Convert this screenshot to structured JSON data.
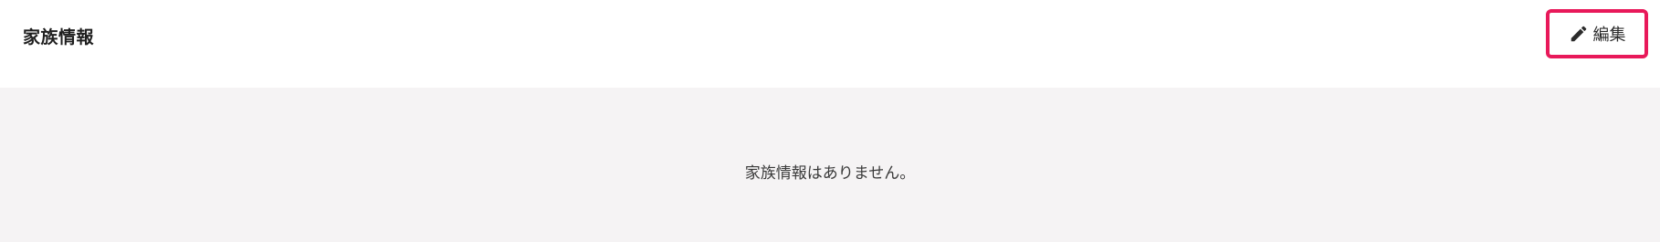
{
  "section": {
    "title": "家族情報",
    "edit_label": "編集",
    "edit_icon": "pencil-icon",
    "empty_message": "家族情報はありません。"
  },
  "colors": {
    "highlight_border": "#e8195a",
    "empty_background": "#f5f3f4"
  }
}
